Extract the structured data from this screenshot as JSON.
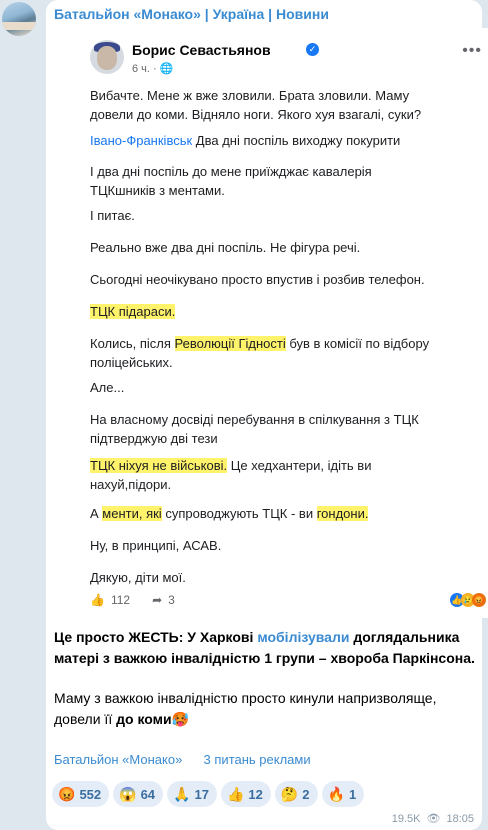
{
  "channel": {
    "name": "Батальйон «Монако» | Україна | Новини"
  },
  "post": {
    "author": "Борис Севастьянов",
    "time": "6 ч.",
    "dot": "·",
    "p1": [
      "Вибачте. Мене ж вже зловили. Брата зловили. Маму",
      "довели до коми. Відняло ноги. Якого хуя взагалі, суки?"
    ],
    "p2_link": "Івано-Франківськ",
    "p2_rest": " Два дні поспіль виходжу покурити",
    "p3": [
      "І два дні поспіль до мене приїжджає кавалерія",
      "ТЦКшників з ментами."
    ],
    "p4": "І питає.",
    "p5": "Реально вже два дні поспіль. Не фігура речі.",
    "p6": "Сьогодні неочікувано просто впустив і розбив телефон.",
    "p7": "ТЦК підараси.",
    "p8_a": "Колись, після ",
    "p8_hl": "Революції Гідності",
    "p8_b": " був в комісії по відбору",
    "p8_2": "поліцейських.",
    "p9": "Але...",
    "p10": [
      "На власному досвіді перебування в спілкування з ТЦК",
      "підтверджую дві тези"
    ],
    "p11_hl": "ТЦК ніхуя не військові.",
    "p11_rest": " Це хедхантери, ідіть ви",
    "p11_2": "нахуй,підори.",
    "p12_a": "А ",
    "p12_hl1": "менти, які",
    "p12_b": " супроводжують ТЦК - ви ",
    "p12_hl2": "гондони.",
    "p13": "Ну, в принципі, АСАВ.",
    "p14": "Дякую, діти мої.",
    "likes": "112",
    "shares": "3"
  },
  "message": {
    "l1": "Це просто ЖЕСТЬ: У Харкові ",
    "l1_link": "мобілізували",
    "l1_end": " доглядальника",
    "l2": "матері з важкою інвалідністю 1 групи – хвороба Паркінсона.",
    "l3": "Маму з важкою інвалідністю просто кинули напризволяще,",
    "l4_a": "довели її ",
    "l4_b": "до коми",
    "l4_emoji": "🥵"
  },
  "signature": {
    "channel": "Батальйон «Монако»",
    "ads": "3 питань реклами"
  },
  "reactions": [
    {
      "emoji": "😡",
      "count": "552"
    },
    {
      "emoji": "😱",
      "count": "64"
    },
    {
      "emoji": "🙏",
      "count": "17"
    },
    {
      "emoji": "👍",
      "count": "12"
    },
    {
      "emoji": "🤔",
      "count": "2"
    },
    {
      "emoji": "🔥",
      "count": "1"
    }
  ],
  "footer": {
    "views": "19.5K",
    "time": "18:05"
  }
}
